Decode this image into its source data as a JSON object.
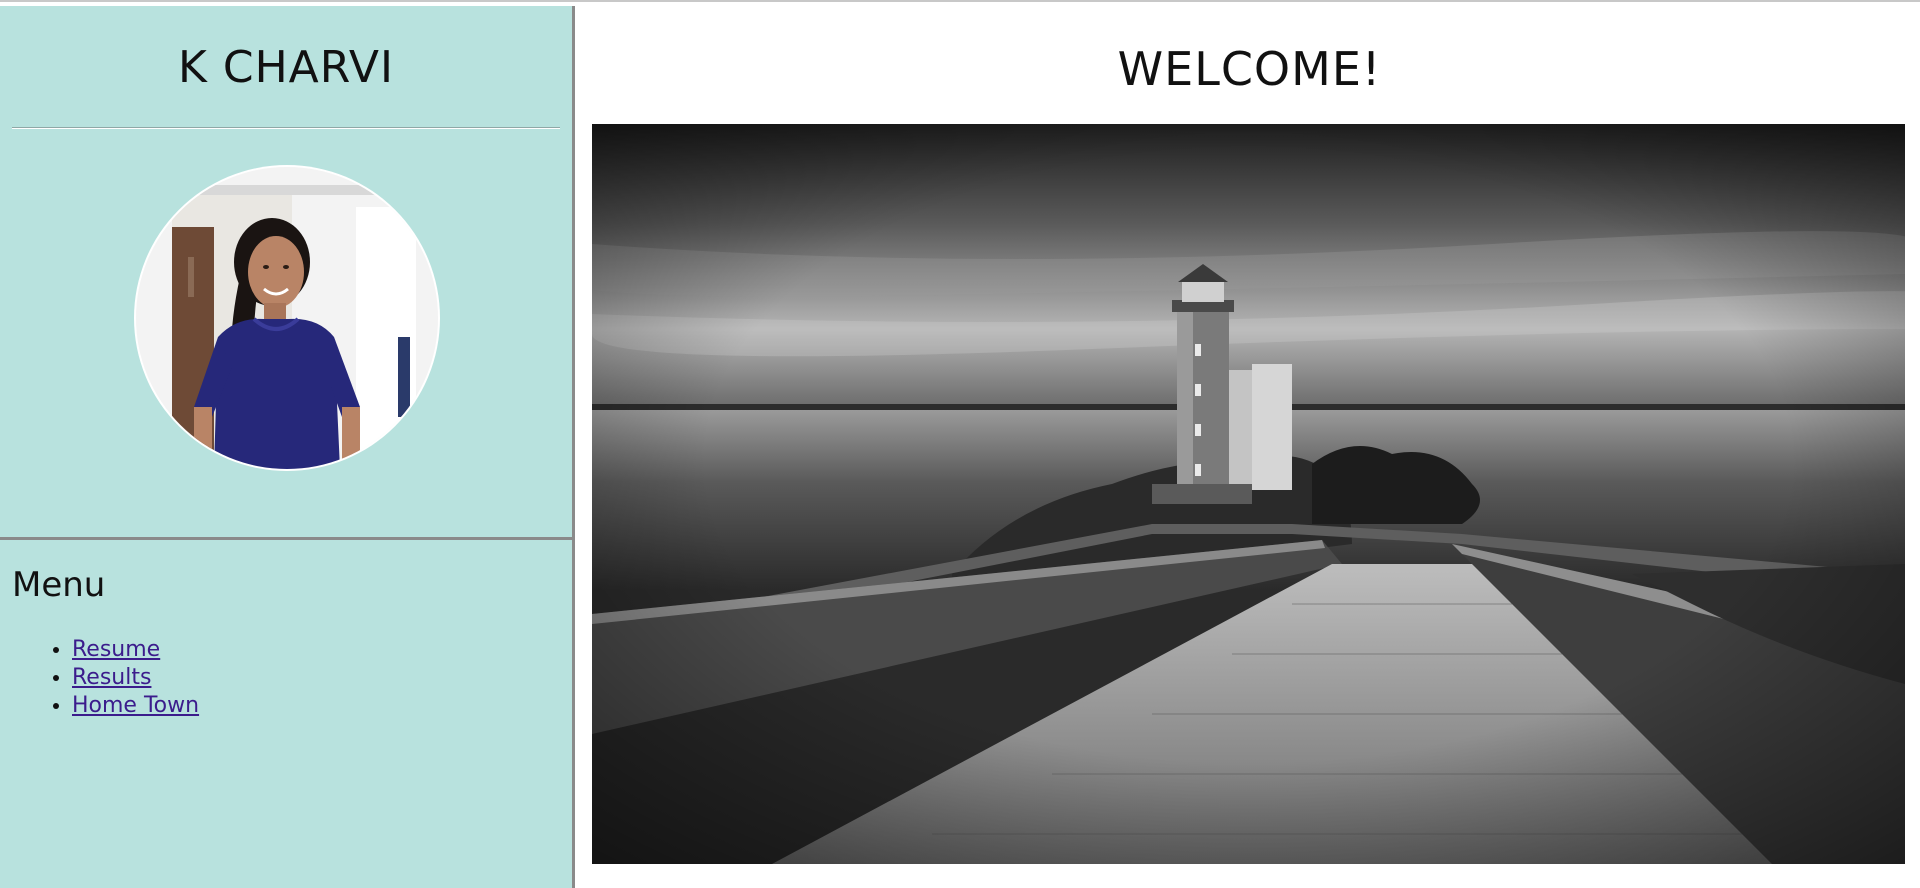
{
  "profile": {
    "name": "K CHARVI",
    "photo_name": "profile-photo"
  },
  "main": {
    "heading": "WELCOME!",
    "hero_name": "lighthouse-photo"
  },
  "menu": {
    "title": "Menu",
    "items": [
      {
        "label": "Resume"
      },
      {
        "label": "Results"
      },
      {
        "label": "Home Town"
      }
    ]
  },
  "colors": {
    "sidebar_bg": "#b8e2de",
    "link": "#3b1c8c",
    "frame_border": "#8a8a8a"
  }
}
